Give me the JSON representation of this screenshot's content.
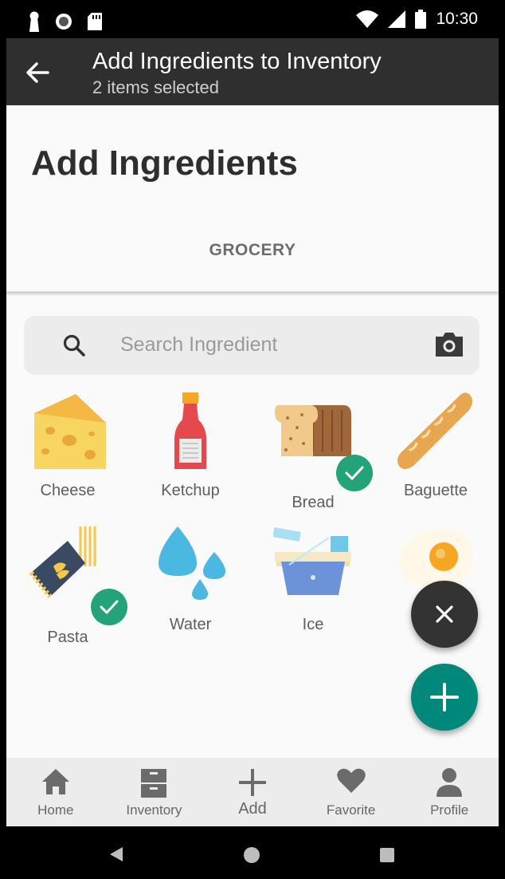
{
  "status_bar": {
    "time": "10:30"
  },
  "app_bar": {
    "title": "Add Ingredients to Inventory",
    "subtitle": "2 items selected"
  },
  "page": {
    "heading": "Add Ingredients",
    "tab": "GROCERY"
  },
  "search": {
    "placeholder": "Search Ingredient"
  },
  "ingredients": [
    {
      "label": "Cheese",
      "selected": false
    },
    {
      "label": "Ketchup",
      "selected": false
    },
    {
      "label": "Bread",
      "selected": true
    },
    {
      "label": "Baguette",
      "selected": false
    },
    {
      "label": "Pasta",
      "selected": true
    },
    {
      "label": "Water",
      "selected": false
    },
    {
      "label": "Ice",
      "selected": false
    },
    {
      "label": "",
      "selected": false
    }
  ],
  "bottom_nav": [
    {
      "label": "Home",
      "icon": "home-icon"
    },
    {
      "label": "Inventory",
      "icon": "cabinet-icon"
    },
    {
      "label": "Add",
      "icon": "plus-icon"
    },
    {
      "label": "Favorite",
      "icon": "heart-icon"
    },
    {
      "label": "Profile",
      "icon": "person-icon"
    }
  ],
  "colors": {
    "app_bar": "#2f2f2f",
    "check": "#24a37a",
    "fab_add": "#00897b",
    "fab_close": "#333333"
  }
}
